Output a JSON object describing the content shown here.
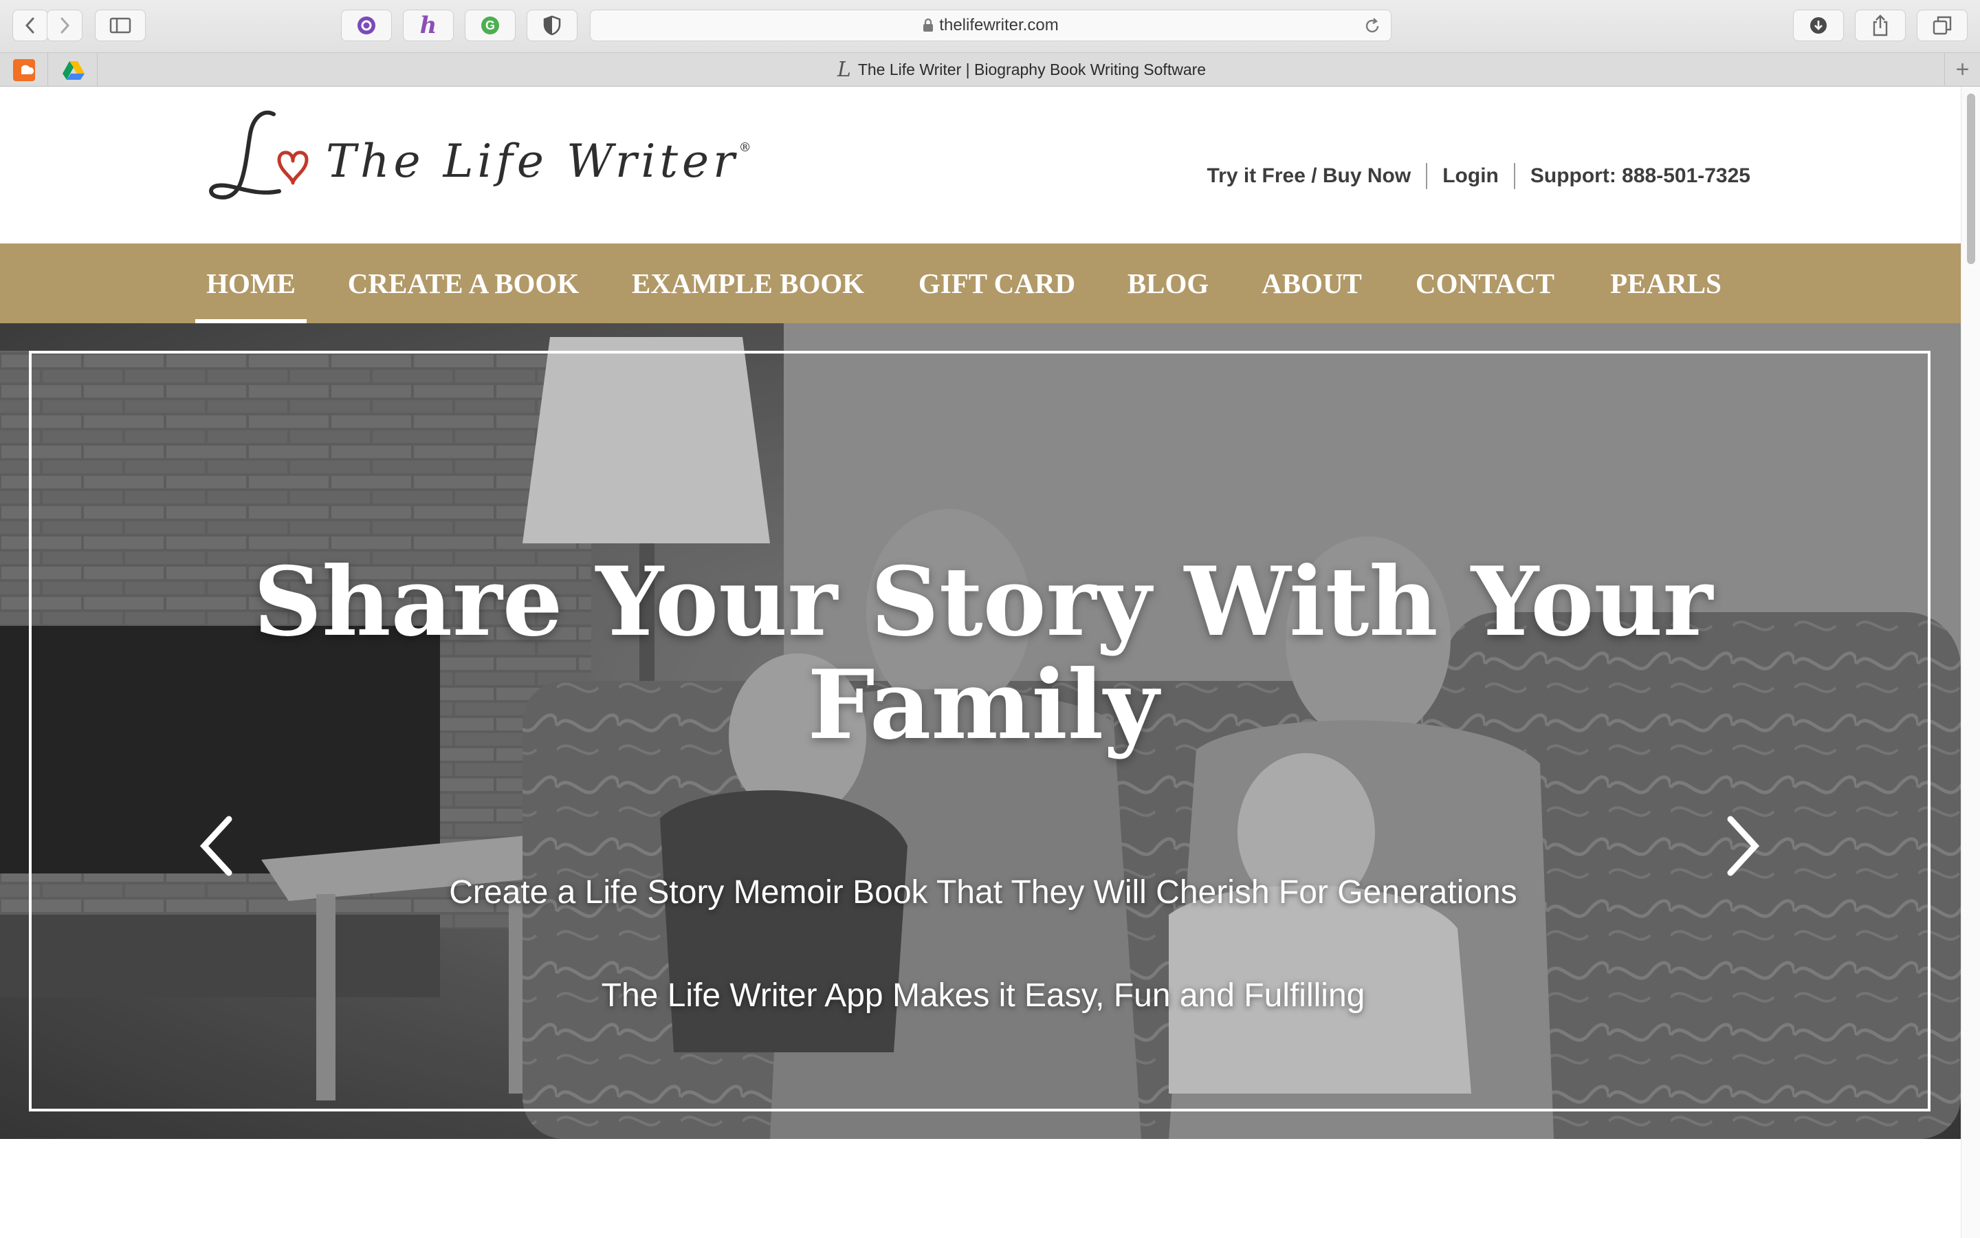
{
  "browser": {
    "url": "thelifewriter.com",
    "tab_title": "The Life Writer | Biography Book Writing Software",
    "tab_favicon": "L",
    "new_tab_label": "+"
  },
  "site": {
    "logo_text": "The Life Writer",
    "logo_mark": "®",
    "top_links": {
      "try_buy": "Try it Free / Buy Now",
      "login": "Login",
      "support": "Support: 888-501-7325"
    },
    "nav": [
      {
        "label": "HOME",
        "active": true
      },
      {
        "label": "CREATE A BOOK",
        "active": false
      },
      {
        "label": "EXAMPLE BOOK",
        "active": false
      },
      {
        "label": "GIFT CARD",
        "active": false
      },
      {
        "label": "BLOG",
        "active": false
      },
      {
        "label": "ABOUT",
        "active": false
      },
      {
        "label": "CONTACT",
        "active": false
      },
      {
        "label": "PEARLS",
        "active": false
      }
    ],
    "nav_color": "#b19968",
    "hero": {
      "title": "Share Your Story With Your Family",
      "subtitle": "Create a Life Story Memoir Book That They Will Cherish For Generations",
      "tagline": "The Life Writer App Makes it Easy, Fun and Fulfilling",
      "prev_icon": "chevron-left-icon",
      "next_icon": "chevron-right-icon"
    }
  }
}
